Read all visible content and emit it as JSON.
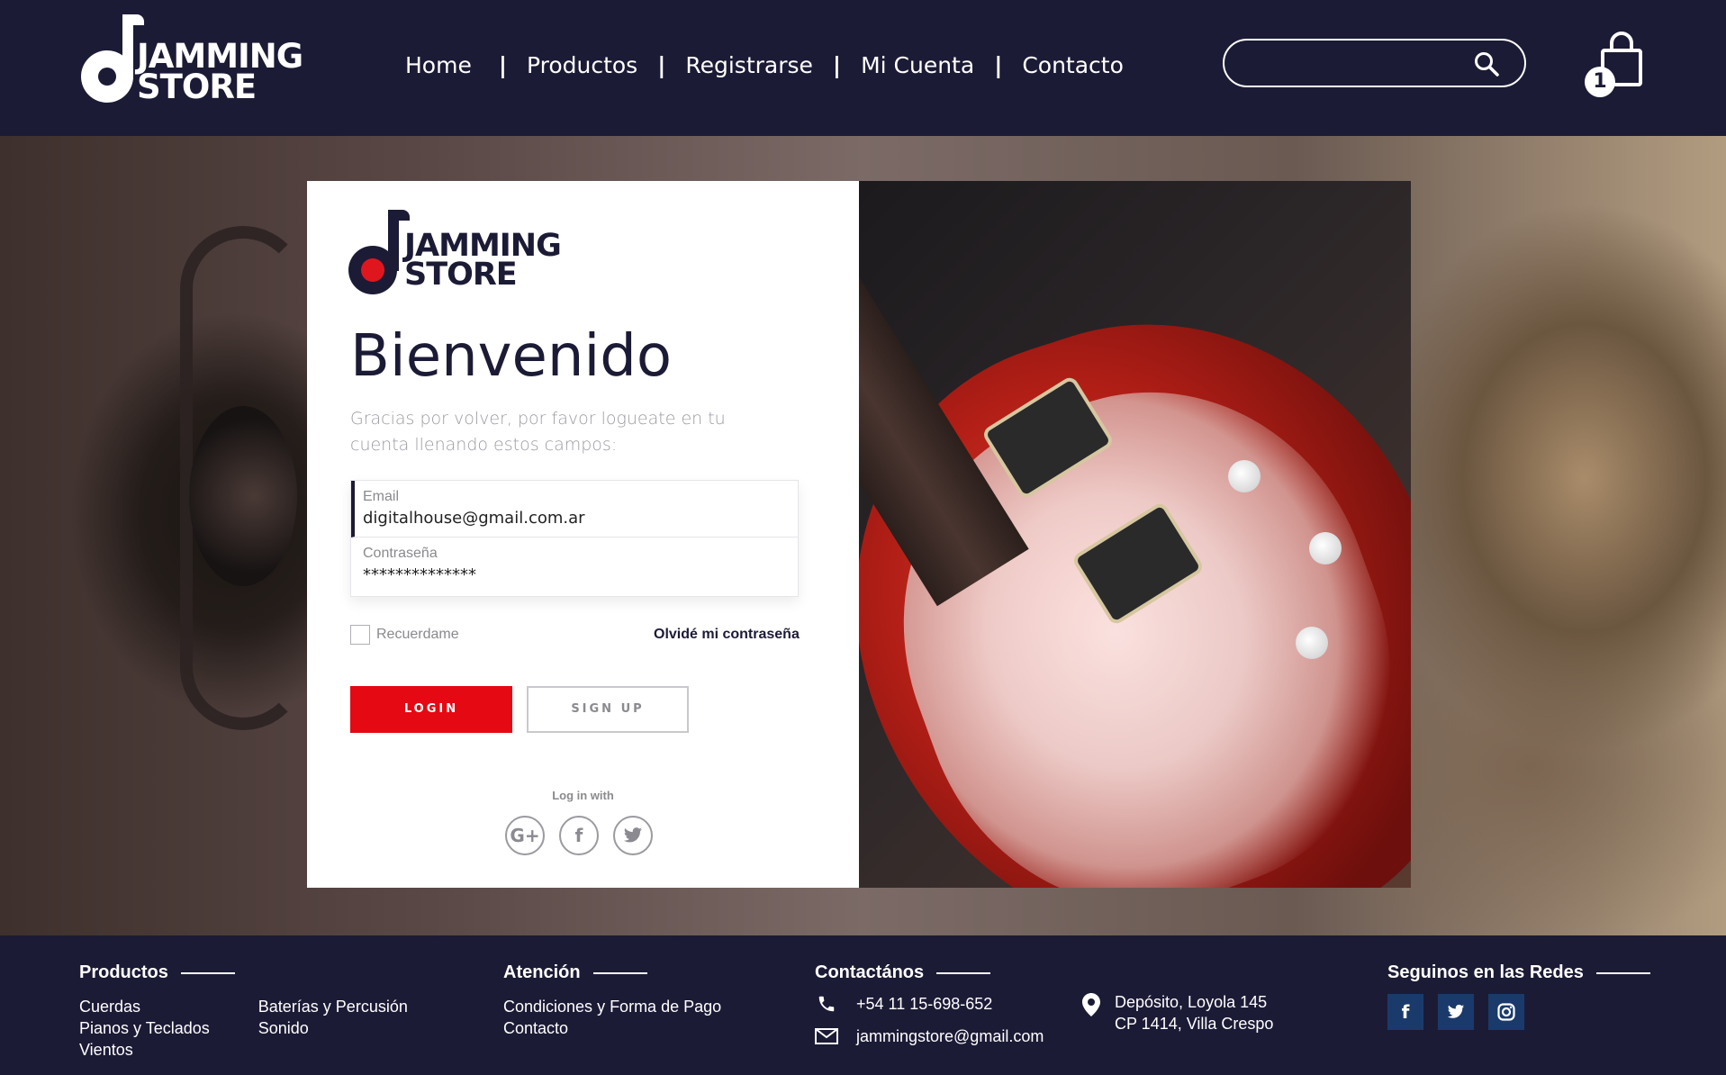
{
  "header": {
    "logo": {
      "line1": "JAMMING",
      "line2": "STORE"
    },
    "nav": [
      {
        "label": "Home"
      },
      {
        "label": "Productos"
      },
      {
        "label": "Registrarse"
      },
      {
        "label": "Mi Cuenta"
      },
      {
        "label": "Contacto"
      }
    ],
    "nav_separator": "|",
    "search": {
      "placeholder": "",
      "value": ""
    },
    "cart": {
      "count": "1"
    }
  },
  "login": {
    "logo": {
      "line1": "JAMMING",
      "line2": "STORE"
    },
    "title": "Bienvenido",
    "subtitle": "Gracias por volver, por favor logueate en tu cuenta llenando estos campos:",
    "email_label": "Email",
    "email_value": "digitalhouse@gmail.com.ar",
    "password_label": "Contraseña",
    "password_value": "**************",
    "remember_label": "Recuerdame",
    "forgot_label": "Olvidé mi contraseña",
    "login_button": "LOGIN",
    "signup_button": "SIGN UP",
    "login_with": "Log in with",
    "social": [
      "google-plus-icon",
      "facebook-icon",
      "twitter-icon"
    ]
  },
  "footer": {
    "productos": {
      "title": "Productos",
      "col1": [
        "Cuerdas",
        "Pianos y Teclados",
        "Vientos"
      ],
      "col2": [
        "Baterías y Percusión",
        "Sonido"
      ]
    },
    "atencion": {
      "title": "Atención",
      "links": [
        "Condiciones y Forma de Pago",
        "Contacto"
      ]
    },
    "contacto": {
      "title": "Contactános",
      "phone": "+54 11 15-698-652",
      "email": "jammingstore@gmail.com",
      "address1": "Depósito, Loyola 145",
      "address2": "CP 1414, Villa Crespo"
    },
    "redes": {
      "title": "Seguinos en las Redes",
      "icons": [
        "facebook-icon",
        "twitter-icon",
        "instagram-icon"
      ]
    }
  },
  "colors": {
    "navy": "#1c1b36",
    "accent_red": "#e50914",
    "social_blue": "#1a3a6b"
  }
}
